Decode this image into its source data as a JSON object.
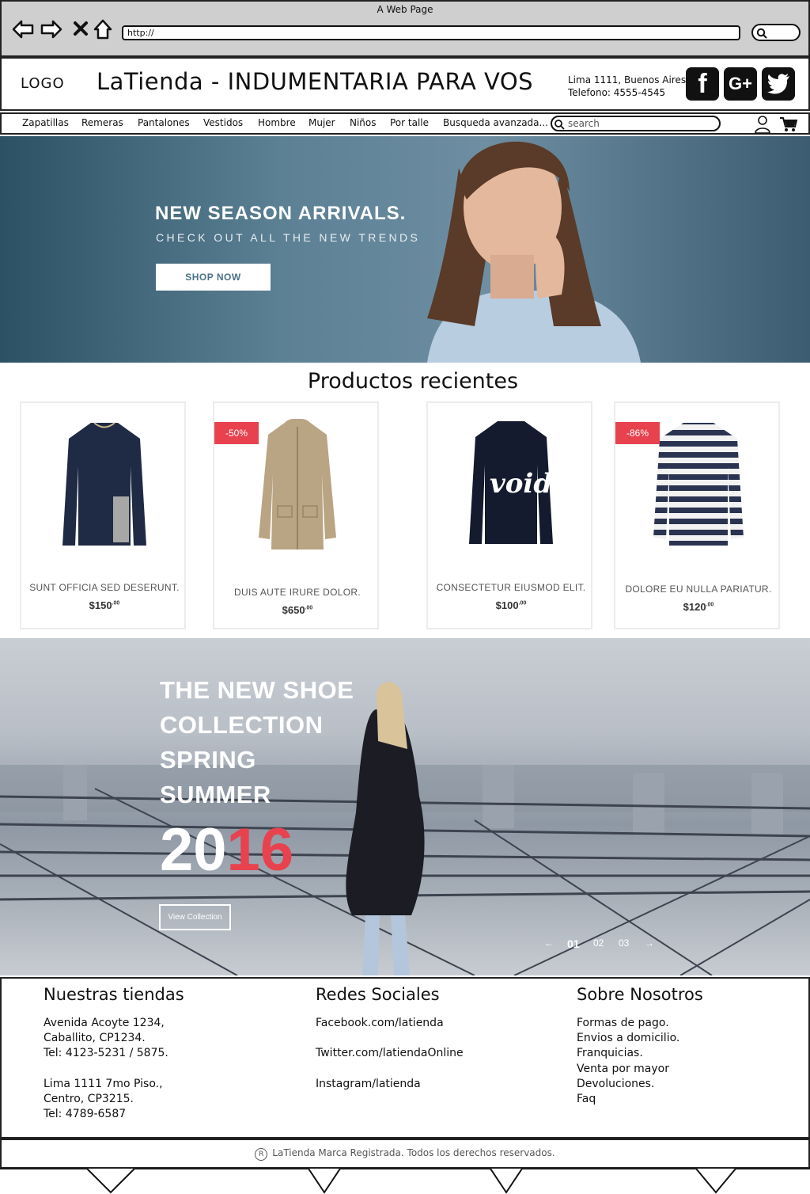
{
  "browser": {
    "window_title": "A Web Page",
    "url": "http://"
  },
  "header": {
    "logo": "LOGO",
    "title": "LaTienda - INDUMENTARIA PARA VOS",
    "address_line1": "Lima 1111, Buenos Aires.",
    "address_line2": "Telefono: 4555-4545",
    "social_icons": [
      "facebook-icon",
      "google-plus-icon",
      "twitter-icon"
    ]
  },
  "menu": {
    "items": [
      "Zapatillas",
      "Remeras",
      "Pantalones",
      "Vestidos",
      "Hombre",
      "Mujer",
      "Niños",
      "Por talle",
      "Busqueda avanzada..."
    ],
    "search_placeholder": "search"
  },
  "hero1": {
    "title": "NEW SEASON ARRIVALS.",
    "subtitle": "CHECK OUT ALL THE NEW TRENDS",
    "button": "SHOP NOW"
  },
  "products": {
    "title": "Productos recientes",
    "items": [
      {
        "name": "SUNT OFFICIA SED DESERUNT.",
        "price": "$150",
        "cents": ".00",
        "badge": ""
      },
      {
        "name": "DUIS AUTE IRURE DOLOR.",
        "price": "$650",
        "cents": ".00",
        "badge": "-50%"
      },
      {
        "name": "CONSECTETUR EIUSMOD ELIT.",
        "price": "$100",
        "cents": ".00",
        "badge": ""
      },
      {
        "name": "DOLORE EU NULLA PARIATUR.",
        "price": "$120",
        "cents": ".00",
        "badge": "-86%"
      }
    ]
  },
  "hero2": {
    "lines": [
      "THE NEW SHOE",
      "COLLECTION",
      "SPRING",
      "SUMMER"
    ],
    "year_white": "20",
    "year_red": "16",
    "button": "View Collection",
    "slider": [
      "←",
      "01",
      "02",
      "03",
      "→"
    ]
  },
  "footer": {
    "stores": {
      "title": "Nuestras tiendas",
      "lines": [
        "Avenida Acoyte 1234,",
        "Caballito, CP1234.",
        "Tel: 4123-5231 / 5875.",
        "Lima 1111 7mo Piso.,",
        "Centro, CP3215.",
        "Tel: 4789-6587"
      ]
    },
    "social": {
      "title": "Redes Sociales",
      "lines": [
        "Facebook.com/latienda",
        "Twitter.com/latiendaOnline",
        "Instagram/latienda"
      ]
    },
    "about": {
      "title": "Sobre Nosotros",
      "lines": [
        "Formas de pago.",
        "Envios a domicilio.",
        "Franquicias.",
        "Venta por mayor",
        "Devoluciones.",
        "Faq"
      ]
    },
    "copyright": "LaTienda Marca Registrada. Todos los derechos reservados."
  },
  "colors": {
    "accent": "#e8424f",
    "hero_blue": "#4a7289"
  }
}
